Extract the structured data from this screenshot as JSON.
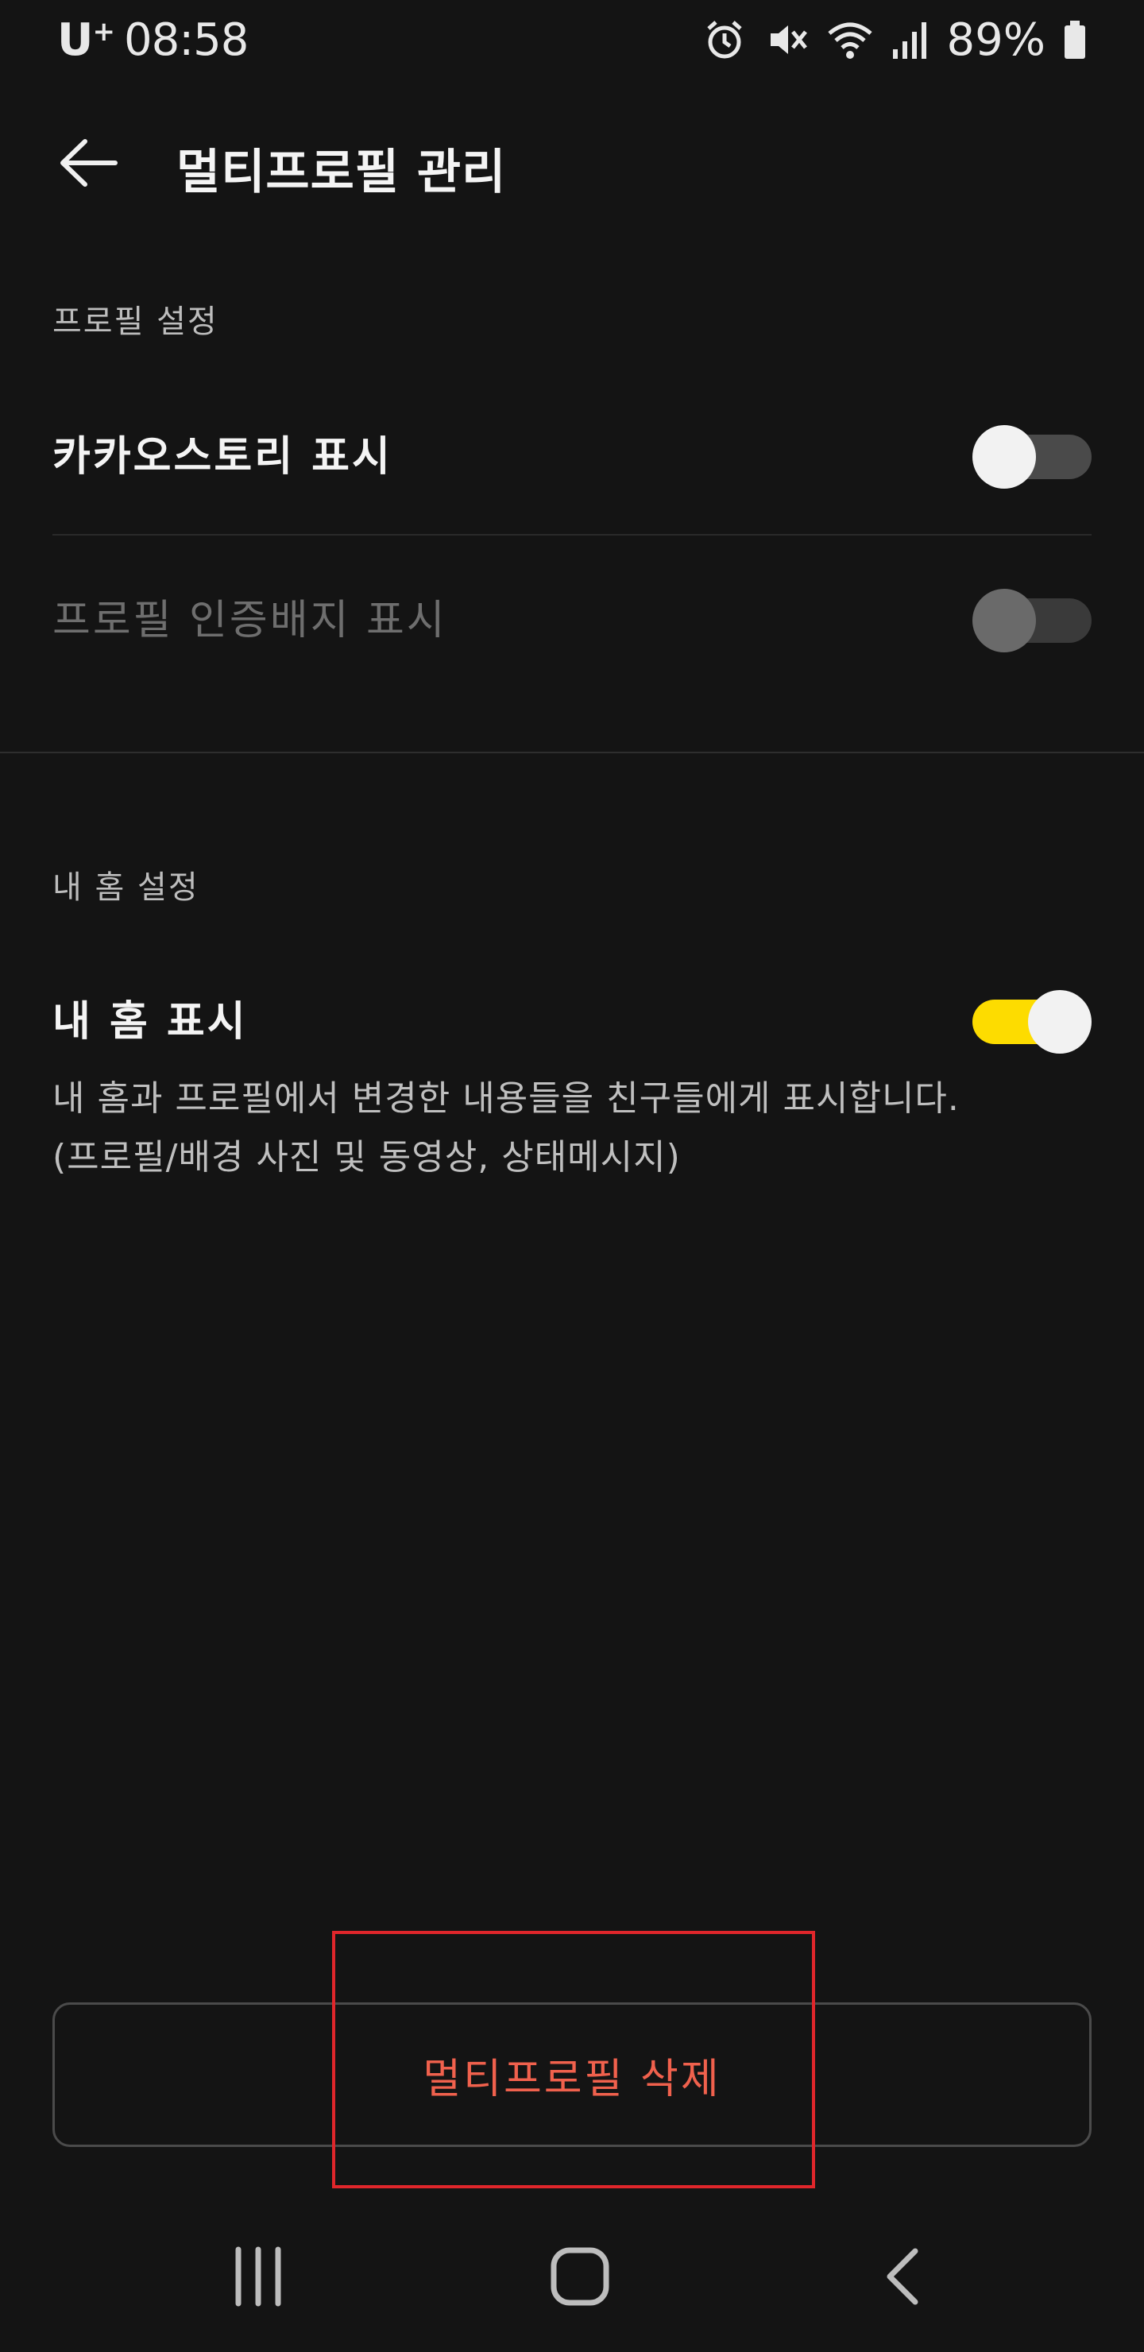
{
  "status_bar": {
    "carrier": "U",
    "carrier_sup": "+",
    "time": "08:58",
    "battery": "89%"
  },
  "app_bar": {
    "title": "멀티프로필 관리"
  },
  "profile_settings": {
    "header": "프로필 설정",
    "rows": [
      {
        "label": "카카오스토리 표시",
        "enabled": true,
        "on": false
      },
      {
        "label": "프로필 인증배지 표시",
        "enabled": false,
        "on": false
      }
    ]
  },
  "home_settings": {
    "header": "내 홈 설정",
    "row": {
      "label": "내 홈 표시",
      "enabled": true,
      "on": true
    },
    "description_line1": "내 홈과 프로필에서 변경한 내용들을 친구들에게 표시합니다.",
    "description_line2": "(프로필/배경 사진 및 동영상, 상태메시지)"
  },
  "actions": {
    "delete_label": "멀티프로필 삭제"
  },
  "colors": {
    "background": "#141414",
    "accent": "#fddc00",
    "danger": "#f0614d",
    "highlight": "#e0262b"
  }
}
